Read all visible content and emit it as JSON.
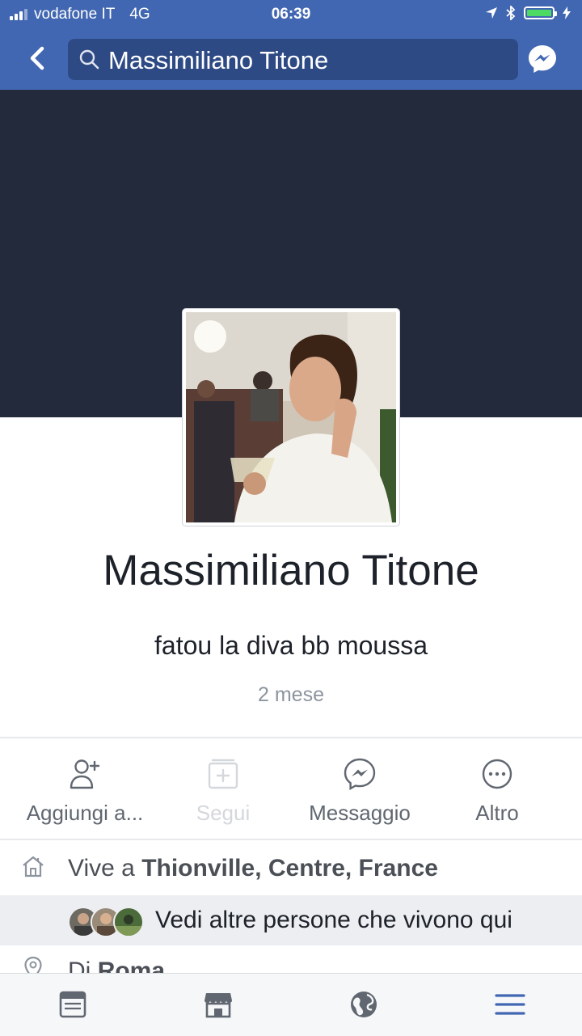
{
  "status_bar": {
    "carrier": "vodafone IT",
    "network": "4G",
    "time": "06:39"
  },
  "nav": {
    "search_query": "Massimiliano Titone",
    "icons": [
      "back-chevron-icon",
      "search-icon",
      "messenger-icon"
    ]
  },
  "profile": {
    "name": "Massimiliano Titone",
    "tagline": "fatou la diva bb moussa",
    "time_ago": "2 mese"
  },
  "actions": [
    {
      "label": "Aggiungi a...",
      "icon": "add-friend-icon",
      "enabled": true
    },
    {
      "label": "Segui",
      "icon": "follow-icon",
      "enabled": false
    },
    {
      "label": "Messaggio",
      "icon": "messenger-icon",
      "enabled": true
    },
    {
      "label": "Altro",
      "icon": "more-icon",
      "enabled": true
    }
  ],
  "info": {
    "lives_prefix": "Vive a",
    "lives_place": "Thionville, Centre, France",
    "see_others": "Vedi altre persone che vivono qui",
    "from_prefix": "Di",
    "from_place": "Roma"
  },
  "tab_bar": [
    "news-feed-icon",
    "marketplace-icon",
    "globe-icon",
    "menu-icon"
  ],
  "colors": {
    "brand_blue": "#4267b2",
    "cover": "#232a3b",
    "active_tab": "#4267b2"
  }
}
